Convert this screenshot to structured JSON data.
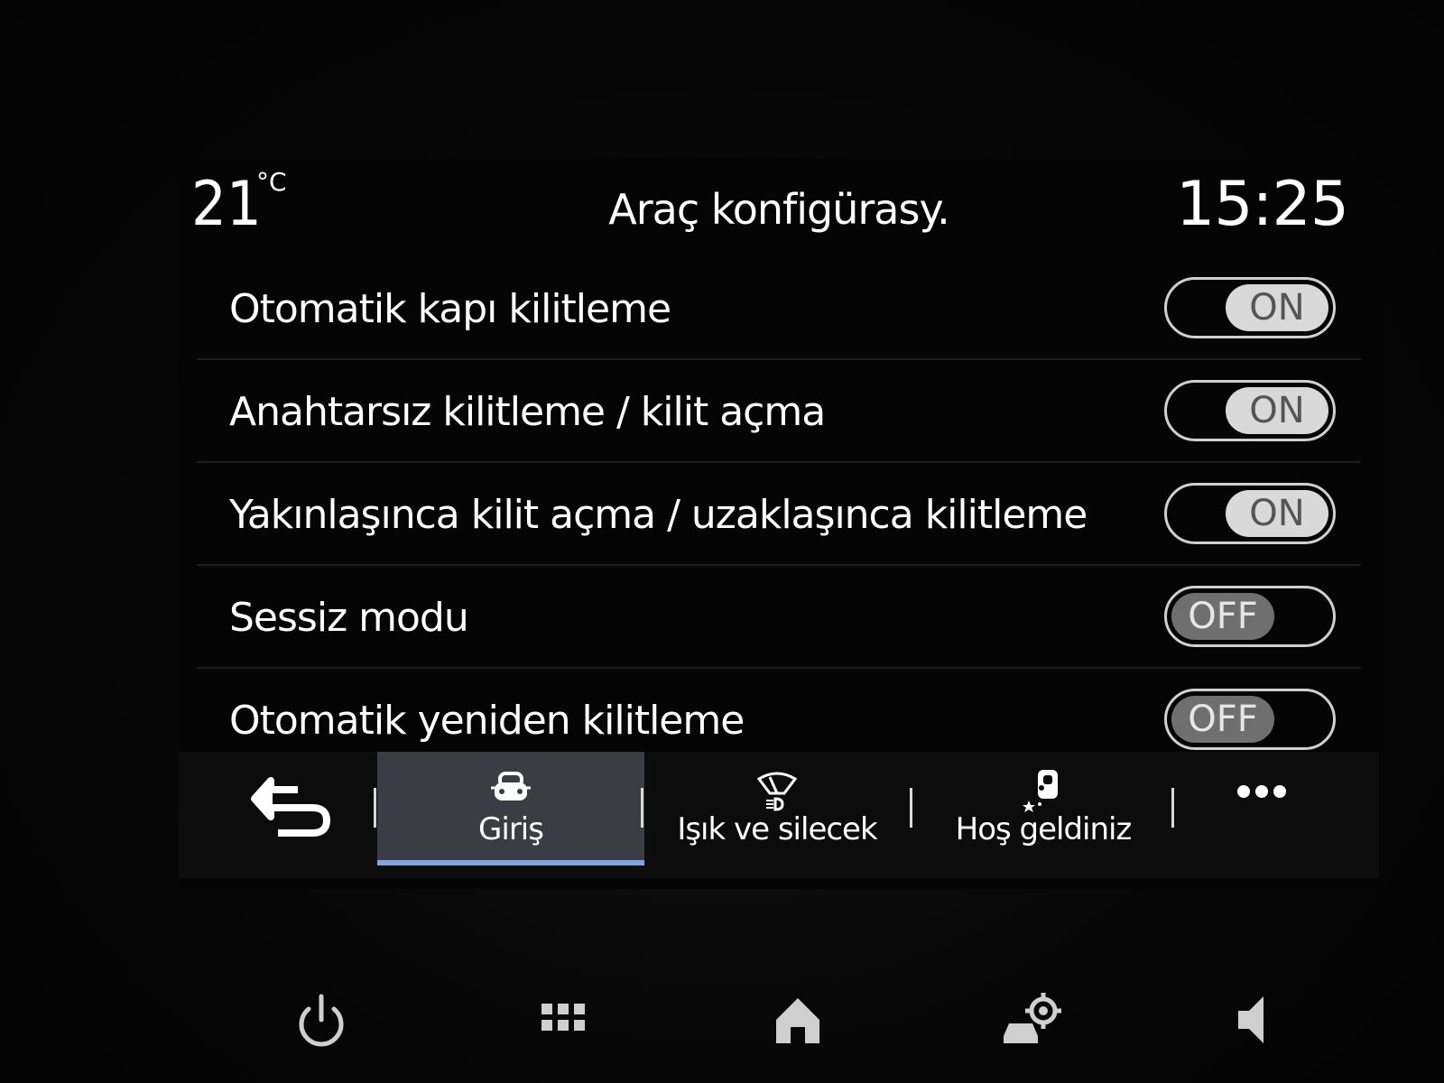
{
  "status": {
    "temperature": "21",
    "temperature_unit": "°C",
    "title": "Araç konfigürasy.",
    "clock": "15:25"
  },
  "settings": [
    {
      "label": "Otomatik kapı kilitleme",
      "state": "ON"
    },
    {
      "label": "Anahtarsız kilitleme / kilit açma",
      "state": "ON"
    },
    {
      "label": "Yakınlaşınca kilit açma / uzaklaşınca kilitleme",
      "state": "ON"
    },
    {
      "label": "Sessiz modu",
      "state": "OFF"
    },
    {
      "label": "Otomatik yeniden kilitleme",
      "state": "OFF"
    }
  ],
  "tabs": [
    {
      "label": "Giriş",
      "icon": "car-lock-icon",
      "active": true
    },
    {
      "label": "Işık ve silecek",
      "icon": "light-wiper-icon",
      "active": false
    },
    {
      "label": "Hoş geldiniz",
      "icon": "welcome-icon",
      "active": false
    }
  ],
  "dock": [
    "power-icon",
    "apps-grid-icon",
    "home-icon",
    "car-settings-icon",
    "volume-icon"
  ],
  "colors": {
    "accent": "#7ea4e0",
    "active_tab_bg": "#3a3d44",
    "on_knob": "#d9d9d9",
    "off_knob": "#6f6f70"
  }
}
